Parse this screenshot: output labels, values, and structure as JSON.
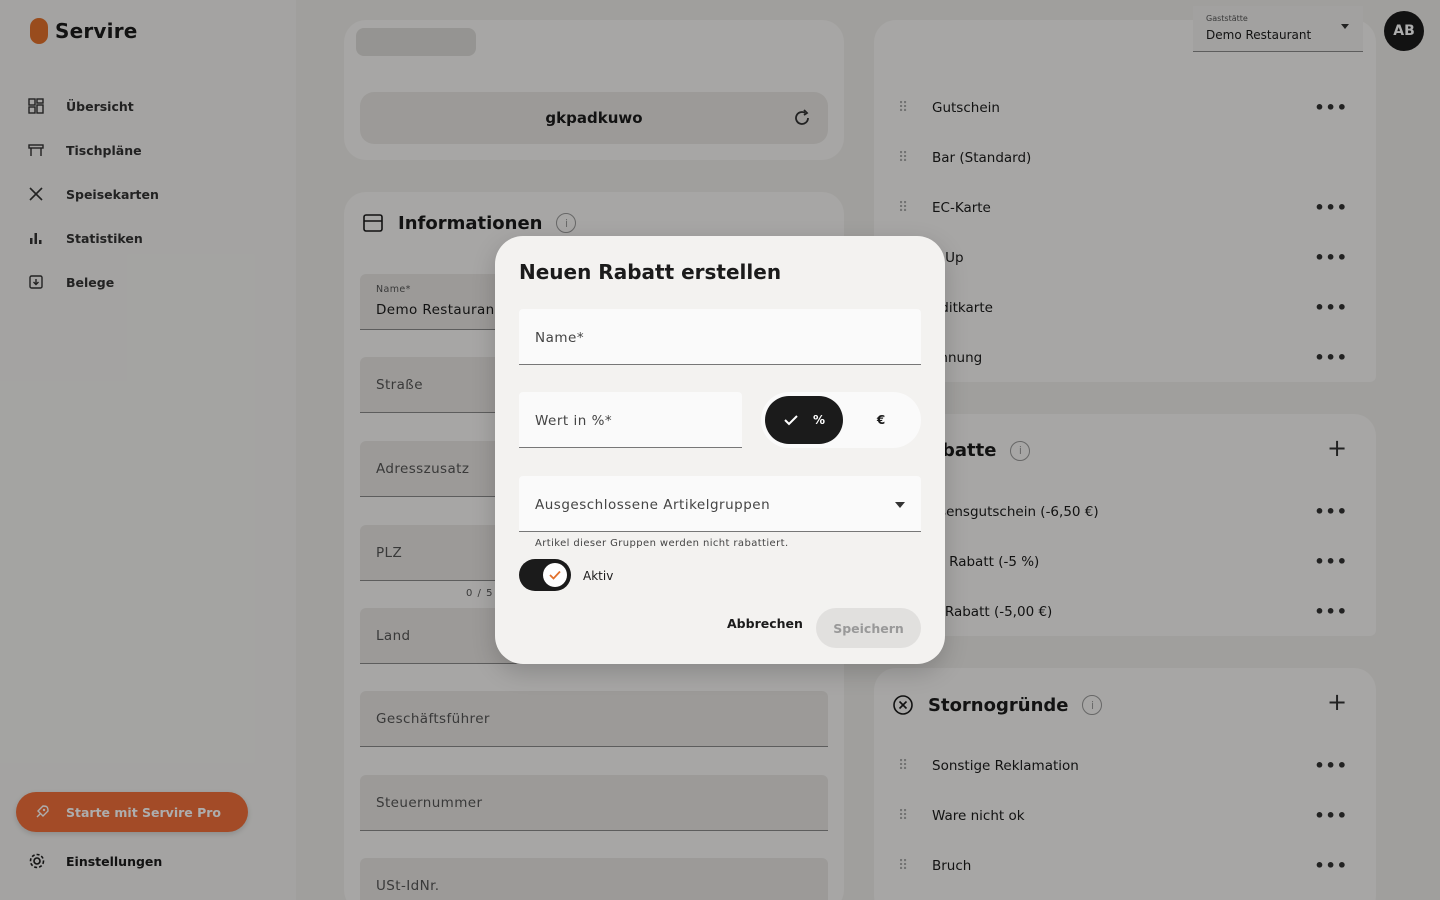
{
  "app": {
    "name": "Servire"
  },
  "sidebar": {
    "items": [
      {
        "label": "Übersicht",
        "icon": "dashboard-icon"
      },
      {
        "label": "Tischpläne",
        "icon": "table-icon"
      },
      {
        "label": "Speisekarten",
        "icon": "cutlery-icon"
      },
      {
        "label": "Statistiken",
        "icon": "bar-chart-icon"
      },
      {
        "label": "Belege",
        "icon": "receipt-icon"
      }
    ],
    "pro_label": "Starte mit Servire Pro",
    "settings_label": "Einstellungen"
  },
  "header": {
    "gaststaette_label": "Gaststätte",
    "gaststaette_value": "Demo Restaurant",
    "avatar_initials": "AB"
  },
  "left_panel": {
    "token": "gkpadkuwo",
    "info_title": "Informationen",
    "fields": {
      "name_label": "Name*",
      "name_value": "Demo Restaurant",
      "street": "Straße",
      "addition": "Adresszusatz",
      "zip": "PLZ",
      "zip_counter": "0 / 5",
      "country": "Land",
      "manager": "Geschäftsführer",
      "tax_number": "Steuernummer",
      "vat_id": "USt-IdNr."
    }
  },
  "right_panel": {
    "payment_methods": [
      "Gutschein",
      "Bar (Standard)",
      "EC-Karte",
      "mUp",
      "editkarte",
      "chnung"
    ],
    "discounts_title": "batte",
    "discounts": [
      "ssensgutschein (-6,50 €)",
      "% Rabatt (-5 %)",
      "€ Rabatt (-5,00 €)"
    ],
    "storno_title": "Stornogründe",
    "storno_reasons": [
      "Sonstige Reklamation",
      "Ware nicht ok",
      "Bruch"
    ]
  },
  "dialog": {
    "title": "Neuen Rabatt erstellen",
    "name_label": "Name*",
    "value_label": "Wert in %*",
    "unit_percent": "%",
    "unit_euro": "€",
    "selected_unit": "%",
    "excluded_groups_label": "Ausgeschlossene Artikelgruppen",
    "hint": "Artikel dieser Gruppen werden nicht rabattiert.",
    "active_label": "Aktiv",
    "active": true,
    "cancel_label": "Abbrechen",
    "save_label": "Speichern"
  },
  "colors": {
    "accent": "#f06f3a",
    "brand_logo": "#e2712c",
    "dark": "#1b1b1b"
  }
}
